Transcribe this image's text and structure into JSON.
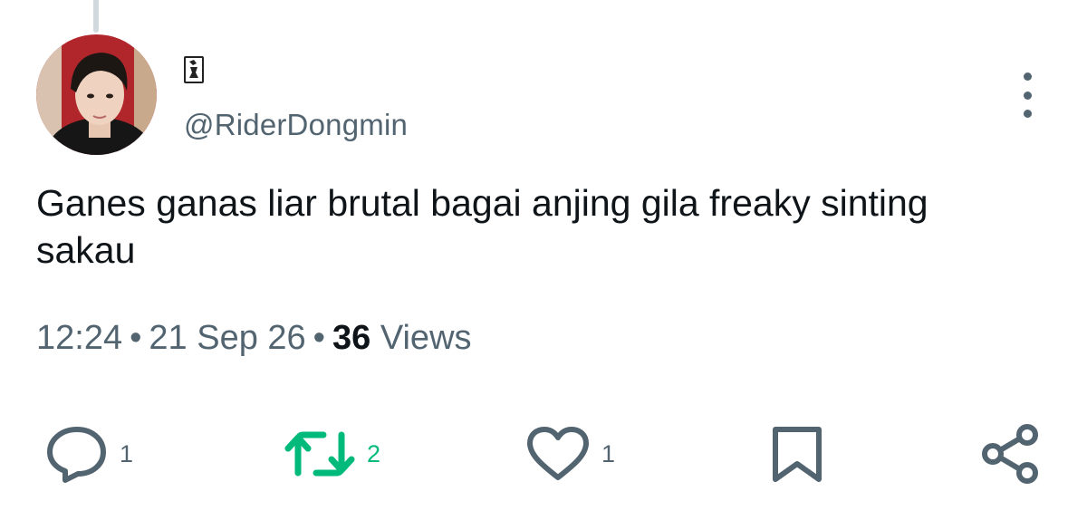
{
  "tweet": {
    "display_name_icon": "emoji-icon",
    "handle": "@RiderDongmin",
    "text": "Ganes ganas liar brutal bagai anjing gila freaky sinting sakau",
    "time": "12:24",
    "separator": "•",
    "date": "21 Sep 26",
    "views_count": "36",
    "views_label": "Views"
  },
  "actions": {
    "reply": {
      "icon": "reply-icon",
      "count": "1"
    },
    "retweet": {
      "icon": "retweet-icon",
      "count": "2",
      "color": "#00ba7c"
    },
    "like": {
      "icon": "heart-icon",
      "count": "1"
    },
    "bookmark": {
      "icon": "bookmark-icon"
    },
    "share": {
      "icon": "share-icon"
    }
  },
  "colors": {
    "primary_text": "#0f1419",
    "secondary_text": "#536471",
    "retweet_active": "#00ba7c",
    "thread_line": "#cfd9de"
  }
}
